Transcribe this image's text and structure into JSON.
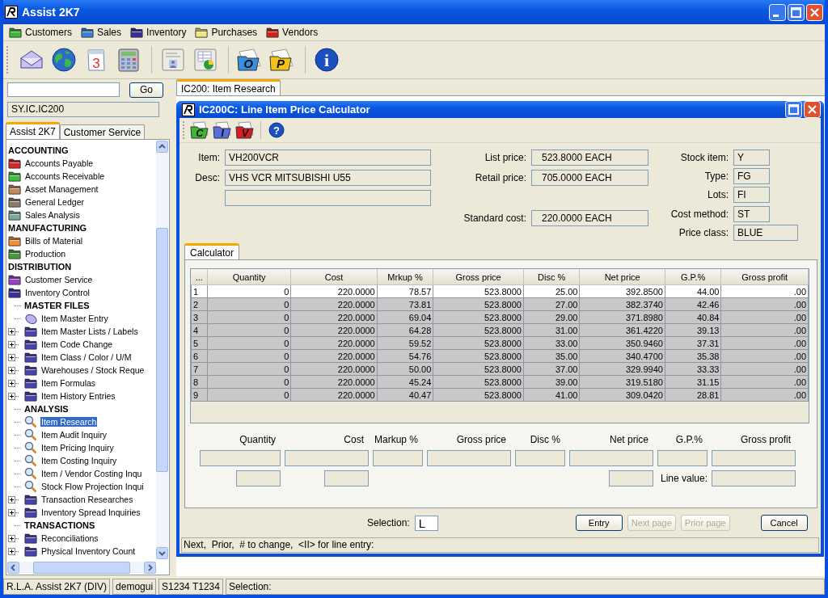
{
  "window": {
    "title": "Assist 2K7"
  },
  "menu": [
    {
      "label": "Customers",
      "color": "#3cb832"
    },
    {
      "label": "Sales",
      "color": "#3a7fd8"
    },
    {
      "label": "Inventory",
      "color": "#3a2f9a"
    },
    {
      "label": "Purchases",
      "color": "#f3e77a"
    },
    {
      "label": "Vendors",
      "color": "#d62020"
    }
  ],
  "toolbar": [
    {
      "kind": "envelope"
    },
    {
      "kind": "globe"
    },
    {
      "kind": "calendar",
      "label": "3"
    },
    {
      "kind": "calculator"
    },
    {
      "kind": "separator"
    },
    {
      "kind": "card"
    },
    {
      "kind": "chart"
    },
    {
      "kind": "separator"
    },
    {
      "kind": "folder",
      "label": "O",
      "color": "#3a8ee0"
    },
    {
      "kind": "folder",
      "label": "P",
      "color": "#f2c21a"
    },
    {
      "kind": "separator"
    },
    {
      "kind": "info",
      "label": "i"
    }
  ],
  "search": {
    "button": "Go"
  },
  "path": "SY.IC.IC200",
  "nav_tabs": [
    {
      "label": "Assist 2K7",
      "selected": true
    },
    {
      "label": "Customer Service",
      "selected": false
    }
  ],
  "tree": [
    {
      "kind": "heading",
      "label": "ACCOUNTING"
    },
    {
      "kind": "folder",
      "label": "Accounts Payable",
      "color": "#d42626",
      "selected": false
    },
    {
      "kind": "folder",
      "label": "Accounts Receivable",
      "color": "#3cc03c",
      "selected": false
    },
    {
      "kind": "folder",
      "label": "Asset Management",
      "color": "#c08a5a",
      "selected": false
    },
    {
      "kind": "folder",
      "label": "General Ledger",
      "color": "#8a7a6a",
      "selected": false
    },
    {
      "kind": "folder",
      "label": "Sales Analysis",
      "color": "#7aa8a0",
      "selected": false
    },
    {
      "kind": "heading",
      "label": "MANUFACTURING"
    },
    {
      "kind": "folder",
      "label": "Bills of Material",
      "color": "#f09030",
      "selected": false
    },
    {
      "kind": "folder",
      "label": "Production",
      "color": "#4a9a3a",
      "selected": false
    },
    {
      "kind": "heading",
      "label": "DISTRIBUTION"
    },
    {
      "kind": "folder",
      "label": "Customer Service",
      "color": "#9a40c8",
      "selected": false
    },
    {
      "kind": "folder",
      "label": "Inventory Control",
      "color": "#3a30a0",
      "selected": false,
      "children": [
        {
          "kind": "heading",
          "label": "MASTER FILES"
        },
        {
          "kind": "entry",
          "label": "Item Master Entry",
          "selected": false
        },
        {
          "kind": "folder",
          "label": "Item Master Lists / Labels",
          "color": "#4a40b0",
          "expanded": false,
          "selected": false
        },
        {
          "kind": "folder",
          "label": "Item Code Change",
          "color": "#4a40b0",
          "expanded": false,
          "selected": false
        },
        {
          "kind": "folder",
          "label": "Item Class / Color / U/M",
          "color": "#4a40b0",
          "expanded": false,
          "selected": false
        },
        {
          "kind": "folder",
          "label": "Warehouses / Stock Reque",
          "color": "#4a40b0",
          "expanded": false,
          "selected": false
        },
        {
          "kind": "folder",
          "label": "Item Formulas",
          "color": "#4a40b0",
          "expanded": false,
          "selected": false
        },
        {
          "kind": "folder",
          "label": "Item History Entries",
          "color": "#4a40b0",
          "expanded": false,
          "selected": false
        },
        {
          "kind": "heading",
          "label": "ANALYSIS"
        },
        {
          "kind": "search",
          "label": "Item Research",
          "selected": true
        },
        {
          "kind": "search",
          "label": "Item Audit Inquiry",
          "selected": false
        },
        {
          "kind": "search",
          "label": "Item Pricing Inquiry",
          "selected": false
        },
        {
          "kind": "search",
          "label": "Item Costing Inquiry",
          "selected": false
        },
        {
          "kind": "search",
          "label": "Item / Vendor Costing Inqu",
          "selected": false
        },
        {
          "kind": "search",
          "label": "Stock Flow Projection Inqui",
          "selected": false
        },
        {
          "kind": "folder",
          "label": "Transaction Researches",
          "color": "#4a40b0",
          "expanded": false,
          "selected": false
        },
        {
          "kind": "folder",
          "label": "Inventory Spread Inquiries",
          "color": "#4a40b0",
          "expanded": false,
          "selected": false
        },
        {
          "kind": "heading",
          "label": "TRANSACTIONS"
        },
        {
          "kind": "folder",
          "label": "Reconciliations",
          "color": "#4a40b0",
          "expanded": false,
          "selected": false
        },
        {
          "kind": "folder",
          "label": "Physical Inventory Count",
          "color": "#4a40b0",
          "expanded": false,
          "selected": false
        }
      ]
    }
  ],
  "doc_tabs": [
    {
      "label": "IC200: Item Research",
      "selected": true
    }
  ],
  "dialog": {
    "title": "IC200C: Line Item Price Calculator",
    "toolbar": [
      {
        "kind": "folder",
        "label": "C",
        "color": "#3cb832"
      },
      {
        "kind": "folder",
        "label": "I",
        "color": "#5a6ee0"
      },
      {
        "kind": "folder",
        "label": "V",
        "color": "#d62020"
      },
      {
        "kind": "separator"
      },
      {
        "kind": "help",
        "label": "?"
      }
    ],
    "field_groups": [
      [
        {
          "kind": "field",
          "label": "Item:",
          "value": "VH200VCR"
        },
        {
          "kind": "field",
          "label": "Desc:",
          "value": "VHS VCR MITSUBISHI U55"
        },
        {
          "kind": "field"
        }
      ],
      [
        {
          "kind": "field",
          "label": "List price:",
          "value": "523.8000 EACH"
        },
        {
          "kind": "field",
          "label": "Retail price:",
          "value": "705.0000 EACH"
        },
        {
          "kind": "gap"
        },
        {
          "kind": "field",
          "label": "Standard cost:",
          "value": "220.0000 EACH"
        }
      ],
      [
        {
          "kind": "field",
          "label": "Stock item:",
          "value": "Y"
        },
        {
          "kind": "field",
          "label": "Type:",
          "value": "FG"
        },
        {
          "kind": "field",
          "label": "Lots:",
          "value": "FI"
        },
        {
          "kind": "field",
          "label": "Cost method:",
          "value": "ST"
        },
        {
          "kind": "long_field",
          "label": "Price class:",
          "value": "BLUE"
        }
      ]
    ],
    "tabs": [
      {
        "label": "Calculator",
        "selected": true
      }
    ],
    "grid": {
      "columns": [
        "...",
        "Quantity",
        "Cost",
        "Mrkup %",
        "Gross price",
        "Disc %",
        "Net price",
        "G.P.%",
        "Gross profit"
      ],
      "rows": [
        {
          "selected": true,
          "cells": [
            "1",
            "0",
            "220.0000",
            "78.57",
            "523.8000",
            "25.00",
            "392.8500",
            "44.00",
            ".00"
          ]
        },
        {
          "selected": false,
          "cells": [
            "2",
            "0",
            "220.0000",
            "73.81",
            "523.8000",
            "27.00",
            "382.3740",
            "42.46",
            ".00"
          ]
        },
        {
          "selected": false,
          "cells": [
            "3",
            "0",
            "220.0000",
            "69.04",
            "523.8000",
            "29.00",
            "371.8980",
            "40.84",
            ".00"
          ]
        },
        {
          "selected": false,
          "cells": [
            "4",
            "0",
            "220.0000",
            "64.28",
            "523.8000",
            "31.00",
            "361.4220",
            "39.13",
            ".00"
          ]
        },
        {
          "selected": false,
          "cells": [
            "5",
            "0",
            "220.0000",
            "59.52",
            "523.8000",
            "33.00",
            "350.9460",
            "37.31",
            ".00"
          ]
        },
        {
          "selected": false,
          "cells": [
            "6",
            "0",
            "220.0000",
            "54.76",
            "523.8000",
            "35.00",
            "340.4700",
            "35.38",
            ".00"
          ]
        },
        {
          "selected": false,
          "cells": [
            "7",
            "0",
            "220.0000",
            "50.00",
            "523.8000",
            "37.00",
            "329.9940",
            "33.33",
            ".00"
          ]
        },
        {
          "selected": false,
          "cells": [
            "8",
            "0",
            "220.0000",
            "45.24",
            "523.8000",
            "39.00",
            "319.5180",
            "31.15",
            ".00"
          ]
        },
        {
          "selected": false,
          "cells": [
            "9",
            "0",
            "220.0000",
            "40.47",
            "523.8000",
            "41.00",
            "309.0420",
            "28.81",
            ".00"
          ]
        }
      ]
    },
    "entry_form": {
      "columns": [
        "Quantity",
        "Cost",
        "Markup %",
        "Gross price",
        "Disc %",
        "Net price",
        "G.P.%",
        "Gross profit"
      ],
      "second_row": [
        {
          "kind": "field"
        },
        {
          "kind": "field"
        },
        {
          "kind": "blank"
        },
        {
          "kind": "blank"
        },
        {
          "kind": "blank"
        },
        {
          "kind": "field"
        },
        {
          "kind": "label",
          "label": "Line value:"
        },
        {
          "kind": "wide_field"
        }
      ]
    },
    "selection": {
      "label": "Selection:",
      "value": "L"
    },
    "buttons": [
      {
        "label": "Entry",
        "disabled": false
      },
      {
        "label": "Next page",
        "disabled": true
      },
      {
        "label": "Prior page",
        "disabled": true
      },
      {
        "label": "Cancel",
        "disabled": false
      }
    ],
    "status": "Next,  Prior,  # to change,  <II> for line entry:"
  },
  "status_bar": [
    "R.L.A. Assist 2K7 (DIV)",
    "demogui",
    "S1234 T1234",
    "Selection:"
  ]
}
